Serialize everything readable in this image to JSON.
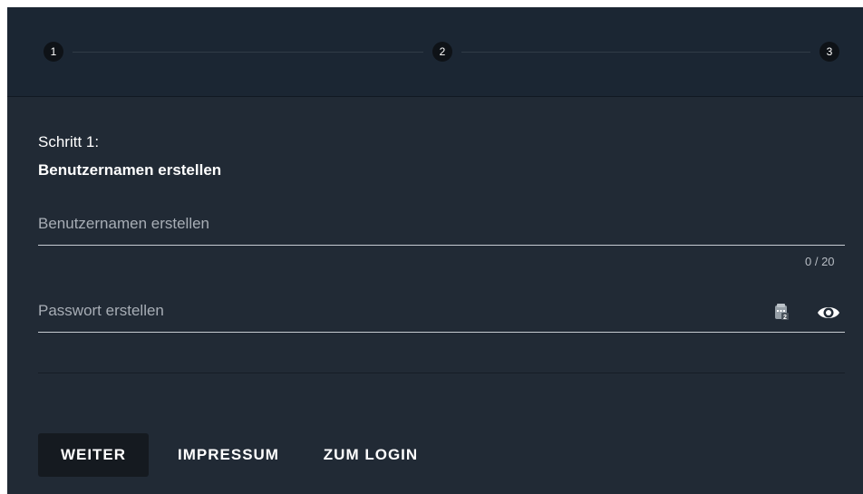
{
  "stepper": {
    "steps": [
      "1",
      "2",
      "3"
    ]
  },
  "content": {
    "step_label": "Schritt 1:",
    "step_title": "Benutzernamen erstellen"
  },
  "form": {
    "username_placeholder": "Benutzernamen erstellen",
    "username_counter": "0 / 20",
    "password_placeholder": "Passwort erstellen",
    "password_icons": [
      "keepass-icon",
      "eye-icon"
    ]
  },
  "actions": {
    "next_label": "WEITER",
    "imprint_label": "IMPRESSUM",
    "login_label": "ZUM LOGIN"
  },
  "colors": {
    "card_background": "#212a35",
    "header_background": "#1b2633",
    "step_circle": "#0e1217",
    "primary_button": "#151a20",
    "field_line": "#c7ccd2"
  }
}
